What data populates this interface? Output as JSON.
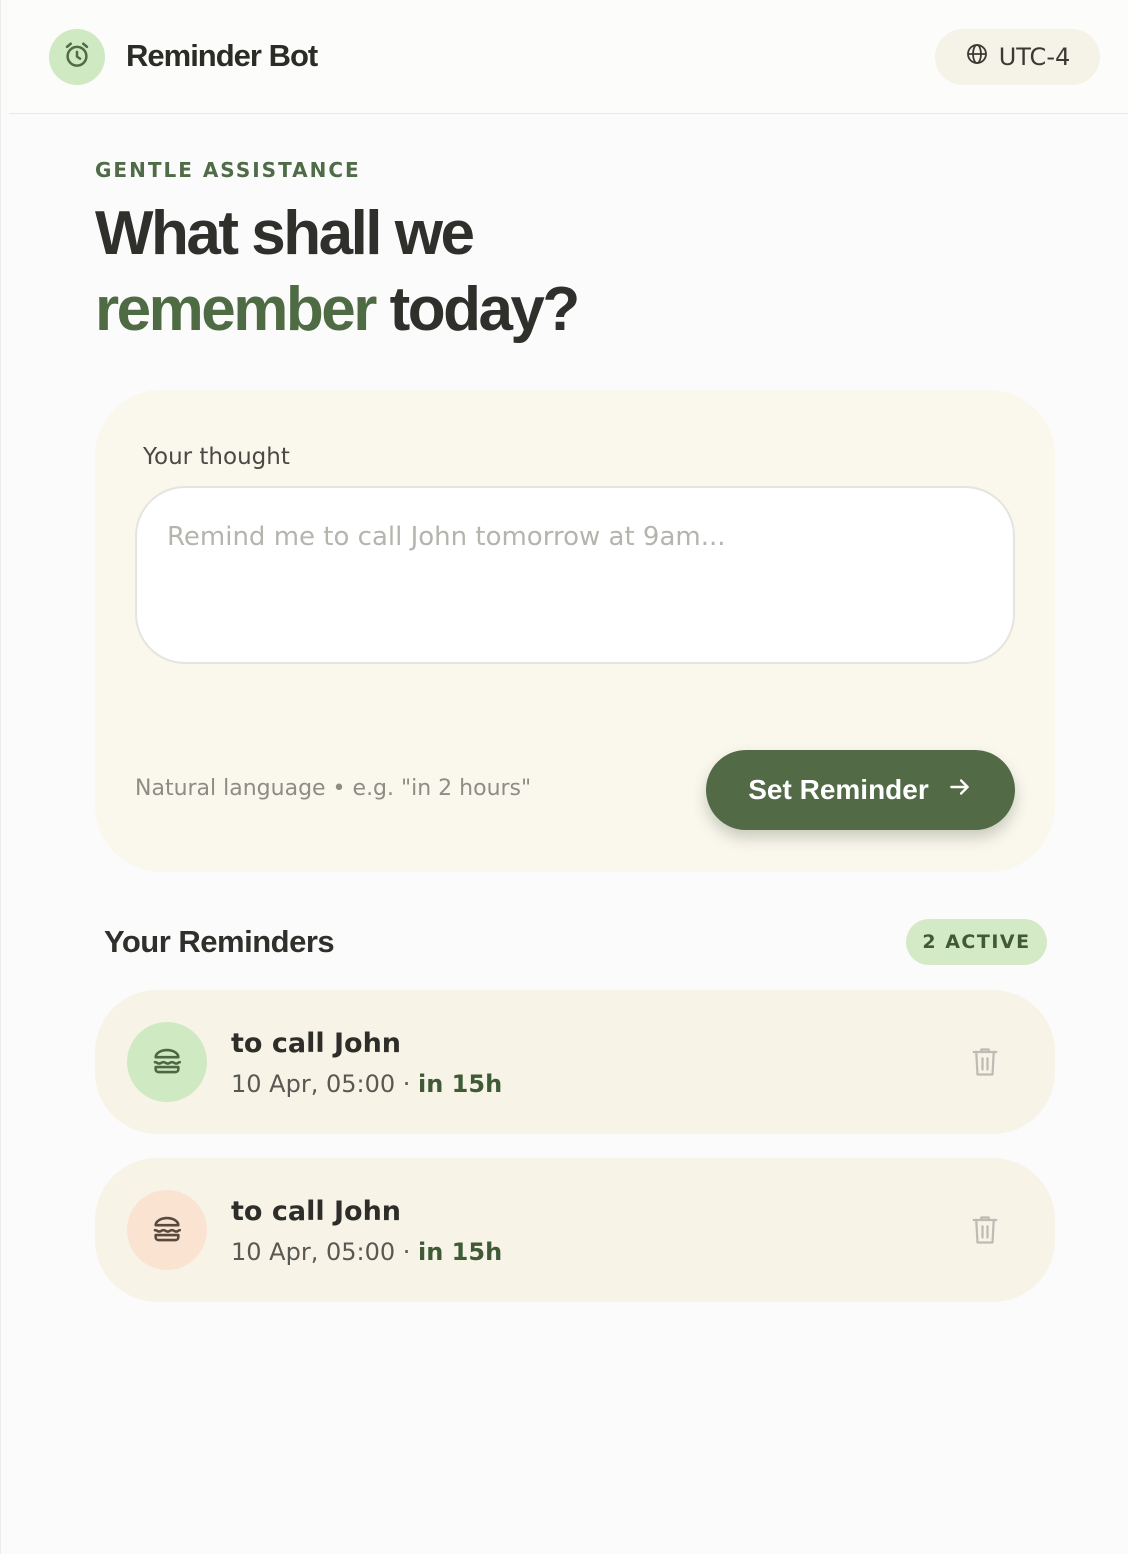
{
  "header": {
    "brand": "Reminder Bot",
    "timezone": "UTC-4",
    "logo_icon": "alarm-clock-icon",
    "timezone_icon": "globe-icon"
  },
  "hero": {
    "eyebrow": "GENTLE ASSISTANCE",
    "line1": "What shall we",
    "accent": "remember",
    "line2_rest": "today?"
  },
  "composer": {
    "label": "Your thought",
    "placeholder": "Remind me to call John tomorrow at 9am...",
    "value": "",
    "hint": "Natural language • e.g. \"in 2 hours\"",
    "submit_label": "Set Reminder",
    "submit_icon": "arrow-right-icon"
  },
  "reminders": {
    "title": "Your Reminders",
    "badge": "2 ACTIVE",
    "items": [
      {
        "title": "to call John",
        "datetime": "10 Apr, 05:00",
        "relative": "in 15h",
        "icon": "burger-icon",
        "icon_bg": "#cfe9c2"
      },
      {
        "title": "to call John",
        "datetime": "10 Apr, 05:00",
        "relative": "in 15h",
        "icon": "burger-icon",
        "icon_bg": "#fbe3d2"
      }
    ]
  },
  "colors": {
    "accent": "#526a45",
    "accent_light": "#cfe9c2",
    "card_bg": "#faf7ed",
    "item_bg": "#f8f3e7",
    "peach": "#fbe3d2"
  }
}
